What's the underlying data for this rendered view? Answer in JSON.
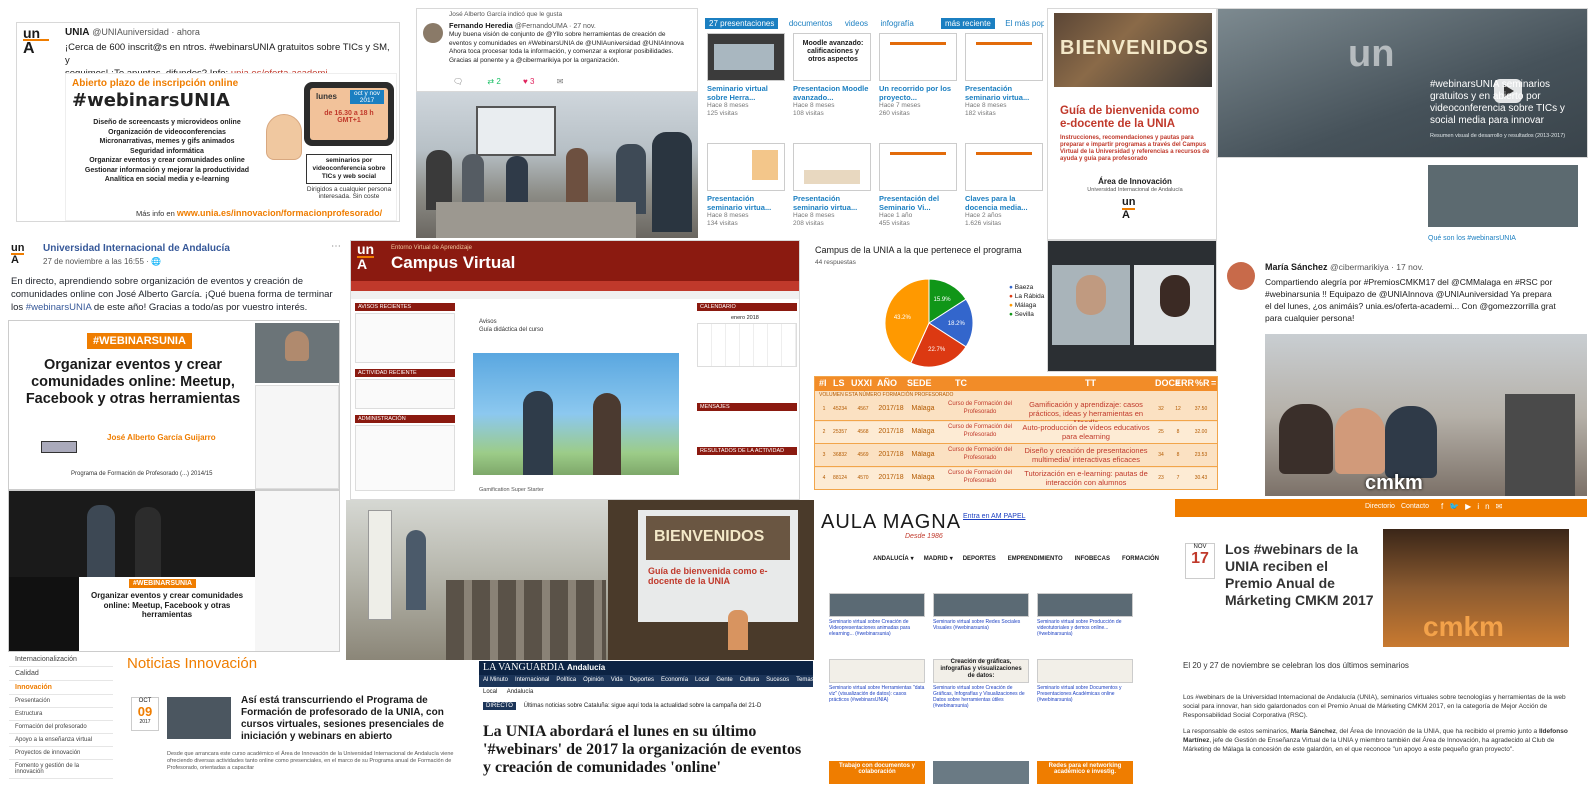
{
  "tweet1": {
    "author": "UNIA",
    "handle": "@UNIAuniversidad · ahora",
    "text_line1": "¡Cerca de 600 inscrit@s en ntros. #webinarsUNIA gratuitos sobre TICs y SM, y",
    "text_line2": "seguimos! ¡Te apuntas, difundes? Info:",
    "link": "unia.es/oferta-academi...",
    "poster_header": "Abierto plazo de inscripción online",
    "poster_title": "#webinarsUNIA",
    "topics": [
      "Diseño de screencasts y microvideos online",
      "Organización de videoconferencias",
      "Micronarrativas, memes y gifs animados",
      "Seguridad informática",
      "Organizar eventos y crear comunidades online",
      "Gestionar información y mejorar la productividad",
      "Analítica en social media y e-learning"
    ],
    "schedule_day": "lunes",
    "schedule_months": "oct y nov 2017",
    "schedule_time": "de 16.30 a 18 h GMT+1",
    "badge": "seminarios por videoconferencia sobre TICs y web social",
    "audience": "Dirigidos a cualquier persona interesada. Sin coste",
    "more_info": "Más info en",
    "more_info_url": "www.unia.es/innovacion/formacionprofesorado/"
  },
  "tweet2": {
    "liked_by": "José Alberto García indicó que le gusta",
    "author": "Fernando Heredia",
    "handle": "@FernandoUMA · 27 nov.",
    "line1": "Muy buena visión de conjunto de @Yllo sobre herramientas de creación de",
    "line2": "eventos y comunidades en #WebinarsUNIA de @UNIAuniversidad @UNIAInnova",
    "line3": "Ahora toca procesar toda la información, y comenzar a explorar posibilidades.",
    "line4": "Gracias al ponente y a @cibermarikiya por la organización.",
    "retweets": "2",
    "likes": "3"
  },
  "slideshare": {
    "tabs": [
      "27 presentaciones",
      "documentos",
      "videos",
      "infografía"
    ],
    "sort_active": "más reciente",
    "sort_other": "El más popular",
    "items": [
      {
        "title": "Seminario virtual sobre Herra...",
        "age": "Hace 8 meses",
        "views": "125 visitas"
      },
      {
        "title": "Presentacion Moodle avanzado...",
        "age": "Hace 8 meses",
        "views": "108 visitas"
      },
      {
        "title": "Un recorrido por los proyecto...",
        "age": "Hace 7 meses",
        "views": "260 visitas"
      },
      {
        "title": "Presentación seminario virtua...",
        "age": "Hace 8 meses",
        "views": "182 visitas"
      },
      {
        "title": "Presentación seminario virtua...",
        "age": "Hace 8 meses",
        "views": "134 visitas"
      },
      {
        "title": "Presentación seminario virtua...",
        "age": "Hace 8 meses",
        "views": "208 visitas"
      },
      {
        "title": "Presentación del Seminario Vi...",
        "age": "Hace 1 año",
        "views": "455 visitas"
      },
      {
        "title": "Claves para la docencia media...",
        "age": "Hace 2 años",
        "views": "1.626 visitas"
      }
    ],
    "thumb_moodle": "Moodle avanzado: calificaciones y otros aspectos"
  },
  "guide": {
    "sign": "BIENVENIDOS",
    "title": "Guía de bienvenida como e-docente de la UNIA",
    "subtitle": "Instrucciones, recomendaciones y pautas para preparar e impartir programas a través del Campus Virtual de la Universidad y referencias a recursos de ayuda y guía para profesorado",
    "area": "Área de Innovación",
    "university": "Universidad Internacional de Andalucía"
  },
  "video": {
    "title": "#webinarsUNIA seminarios gratuitos y en abierto por videoconferencia sobre TICs y social media para innovar",
    "summary": "Resumen visual de desarrollo y resultados (2013-2017)",
    "caption": "Qué son los #webinarsUNIA"
  },
  "fb": {
    "page": "Universidad Internacional de Andalucía",
    "date": "27 de noviembre a las 16:55 · ",
    "text1": "En directo, aprendiendo sobre organización de eventos y creación de",
    "text2": "comunidades online con José Alberto García. ¡Qué buena forma de terminar",
    "text3": "los",
    "hashtag": "#webinarsUNIA",
    "text4": "de este año! Gracias a todo/as por vuestro interés.",
    "slide_tag": "#WEBINARSUNIA",
    "slide_title": "Organizar eventos y crear comunidades online: Meetup, Facebook y otras herramientas",
    "slide_author": "José Alberto García Guijarro",
    "slide_footer": "Programa de Formación de Profesorado (...) 2014/15",
    "small_tag": "#WEBINARSUNIA",
    "small_title": "Organizar eventos y crear comunidades online: Meetup, Facebook y otras herramientas"
  },
  "campus": {
    "brand": "Campus Virtual",
    "tagline": "Entorno Virtual de Aprendizaje",
    "block_news": "AVISOS RECIENTES",
    "block_activity": "ACTIVIDAD RECIENTE",
    "block_admin": "ADMINISTRACIÓN",
    "block_calendar": "CALENDARIO",
    "calendar_month": "enero 2018",
    "block_messages": "MENSAJES",
    "block_results": "RESULTADOS DE LA ACTIVIDAD",
    "forum": "Avisos",
    "guide_link": "Guía didáctica del curso",
    "video_caption": "Gamification Super Starter"
  },
  "poll": {
    "title": "Campus de la UNIA a la que pertenece el programa",
    "responses": "44 respuestas",
    "legend": [
      "Baeza",
      "La Rábida",
      "Málaga",
      "Sevilla"
    ],
    "colors": [
      "#3366cc",
      "#dc3912",
      "#ff9900",
      "#109618"
    ],
    "slices": [
      {
        "label": "Baeza",
        "pct": 18.2
      },
      {
        "label": "La Rábida",
        "pct": 22.7
      },
      {
        "label": "Málaga",
        "pct": 43.2
      },
      {
        "label": "Sevilla",
        "pct": 15.9
      }
    ]
  },
  "table": {
    "headers": [
      "#I",
      "LS",
      "UXXI",
      "AÑO",
      "SEDE",
      "TC",
      "TT",
      "DOC#",
      "ERR",
      "%R",
      "="
    ],
    "subheader": "VOLUMEN ESTA NÚMERO FORMACIÓN PROFESORADO",
    "rows": [
      {
        "i": "1",
        "ls": "45234",
        "uxxi": "4567",
        "ano": "2017/18",
        "sede": "Málaga",
        "tc": "Curso de Formación del Profesorado",
        "tt": "Gamificación y aprendizaje: casos prácticos, ideas y herramientas en Moodle",
        "doc": "32",
        "err": "12",
        "r": "37.50"
      },
      {
        "i": "2",
        "ls": "25357",
        "uxxi": "4568",
        "ano": "2017/18",
        "sede": "Málaga",
        "tc": "Curso de Formación del Profesorado",
        "tt": "Auto-producción de vídeos educativos para elearning",
        "doc": "25",
        "err": "8",
        "r": "32.00"
      },
      {
        "i": "3",
        "ls": "36832",
        "uxxi": "4569",
        "ano": "2017/18",
        "sede": "Málaga",
        "tc": "Curso de Formación del Profesorado",
        "tt": "Diseño y creación de presentaciones multimedia/ interactivas eficaces",
        "doc": "34",
        "err": "8",
        "r": "23.53"
      },
      {
        "i": "4",
        "ls": "88124",
        "uxxi": "4570",
        "ano": "2017/18",
        "sede": "Málaga",
        "tc": "Curso de Formación del Profesorado",
        "tt": "Tutorización en e-learning: pautas de interacción con alumnos",
        "doc": "23",
        "err": "7",
        "r": "30.43"
      }
    ]
  },
  "tweet3": {
    "author": "María Sánchez",
    "handle": "@cibermarikiya · 17 nov.",
    "line1": "Compartiendo alegría por #PremiosCMKM17 del @CMMalaga en #RSC por",
    "line2": "#webinarsunia !! Equipazo de @UNIAInnova @UNIAuniversidad Ya prepara",
    "line3": "el del lunes, ¿os animáis? unia.es/oferta-academi... Con @gomezzorrilla grat",
    "line4": "para cualquier persona!",
    "photo_sign": "cmkm"
  },
  "aula": {
    "logo": "AULA MAGNA",
    "logo_sub": "Desde 1986",
    "link": "Entra en AM PAPEL",
    "nav": [
      "ANDALUCÍA",
      "MADRID",
      "DEPORTES",
      "EMPRENDIMIENTO",
      "INFOBECAS",
      "FORMACIÓN"
    ],
    "cards": [
      "Seminario virtual sobre Creación de Videopresentaciones animadas para elearning... (#webinarsunia)",
      "Seminario virtual sobre Redes Sociales Visuales (#webinarsunia)",
      "Seminario virtual sobre Producción de videotutoriales y demos online... (#webinarsunia)",
      "Seminario virtual sobre Herramientas \"data viz\" (visualización de datos): casos prácticos (#webinarsUNIA)",
      "Seminario virtual sobre Creación de Gráficas, Infografías y Visualizaciones de Datos sobre herramientas útiles (#webinarsunia)",
      "Seminario virtual sobre Documentos y Presentaciones Académicas online (#webinarsunia)"
    ],
    "card_mid_title": "Creación de gráficas, infografías y visualizaciones de datos:",
    "bottom1": "Trabajo con documentos y colaboración",
    "bottom3": "Redes para el networking académico e investig."
  },
  "cmkm": {
    "nav": [
      "Directorio",
      "Contacto"
    ],
    "month": "NOV",
    "day": "17",
    "title": "Los #webinars de la UNIA reciben el Premio Anual de Márketing CMKM 2017",
    "photo_sign": "cmkm",
    "lead": "El 20 y 27 de noviembre se celebran los dos últimos seminarios",
    "body1": "Los #webinars de la Universidad Internacional de Andalucía (UNIA), seminarios virtuales sobre tecnologías y herramientas de la web social para innovar, han sido galardonados con el Premio Anual de Márketing CMKM 2017, en la categoría de Mejor Acción de Responsabilidad Social Corporativa (RSC).",
    "body2a": "La responsable de estos seminarios,",
    "body2_name": "María Sánchez",
    "body2b": ", del Área de Innovación de la UNIA, que ha recibido el premio junto a",
    "body2_name2": "Ildefonso Martínez",
    "body2c": ", jefe de Gestión de Enseñanza Virtual de la UNIA y miembro también del Área de Innovación, ha agradecido al Club de Márketing de Málaga la concesión de este galardón, en el que reconoce \"un apoyo a este pequeño gran proyecto\"."
  },
  "innov": {
    "sidebar": [
      "Internacionalización",
      "Calidad",
      "Innovación",
      "Presentación",
      "Estructura",
      "Formación del profesorado",
      "Apoyo a la enseñanza virtual",
      "Proyectos de innovación",
      "Fomento y gestión de la innovación"
    ],
    "active": "Innovación",
    "heading": "Noticias Innovación",
    "month": "OCT",
    "day": "09",
    "year": "2017",
    "headline": "Así está transcurriendo el Programa de Formación de profesorado de la UNIA, con cursos virtuales, sesiones presenciales de iniciación y webinars en abierto",
    "body": "Desde que arrancara este curso académico el Área de Innovación de la Universidad Internacional de Andalucía viene ofreciendo diversas actividades tanto online como presenciales, en el marco de su Programa anual de Formación de Profesorado, orientadas a capacitar"
  },
  "vanguardia": {
    "brand": "LA VANGUARDIA",
    "section": "Andalucía",
    "nav": [
      "Al Minuto",
      "Internacional",
      "Política",
      "Opinión",
      "Vida",
      "Deportes",
      "Economía",
      "Local",
      "Gente",
      "Cultura",
      "Sucesos",
      "Temas"
    ],
    "subnav": [
      "Local",
      "Andalucía"
    ],
    "live_tag": "DIRECTO",
    "live_text": "Últimas noticias sobre Cataluña: sigue aquí toda la actualidad sobre la campaña del 21-D",
    "headline": "La UNIA abordará el lunes en su último '#webinars' de 2017 la organización de eventos y creación de comunidades 'online'"
  },
  "campus_photo_sign": "BIENVENIDOS",
  "projector": {
    "sign": "BIENVENIDOS",
    "slide_title": "Guía de bienvenida como e-docente de la UNIA"
  }
}
